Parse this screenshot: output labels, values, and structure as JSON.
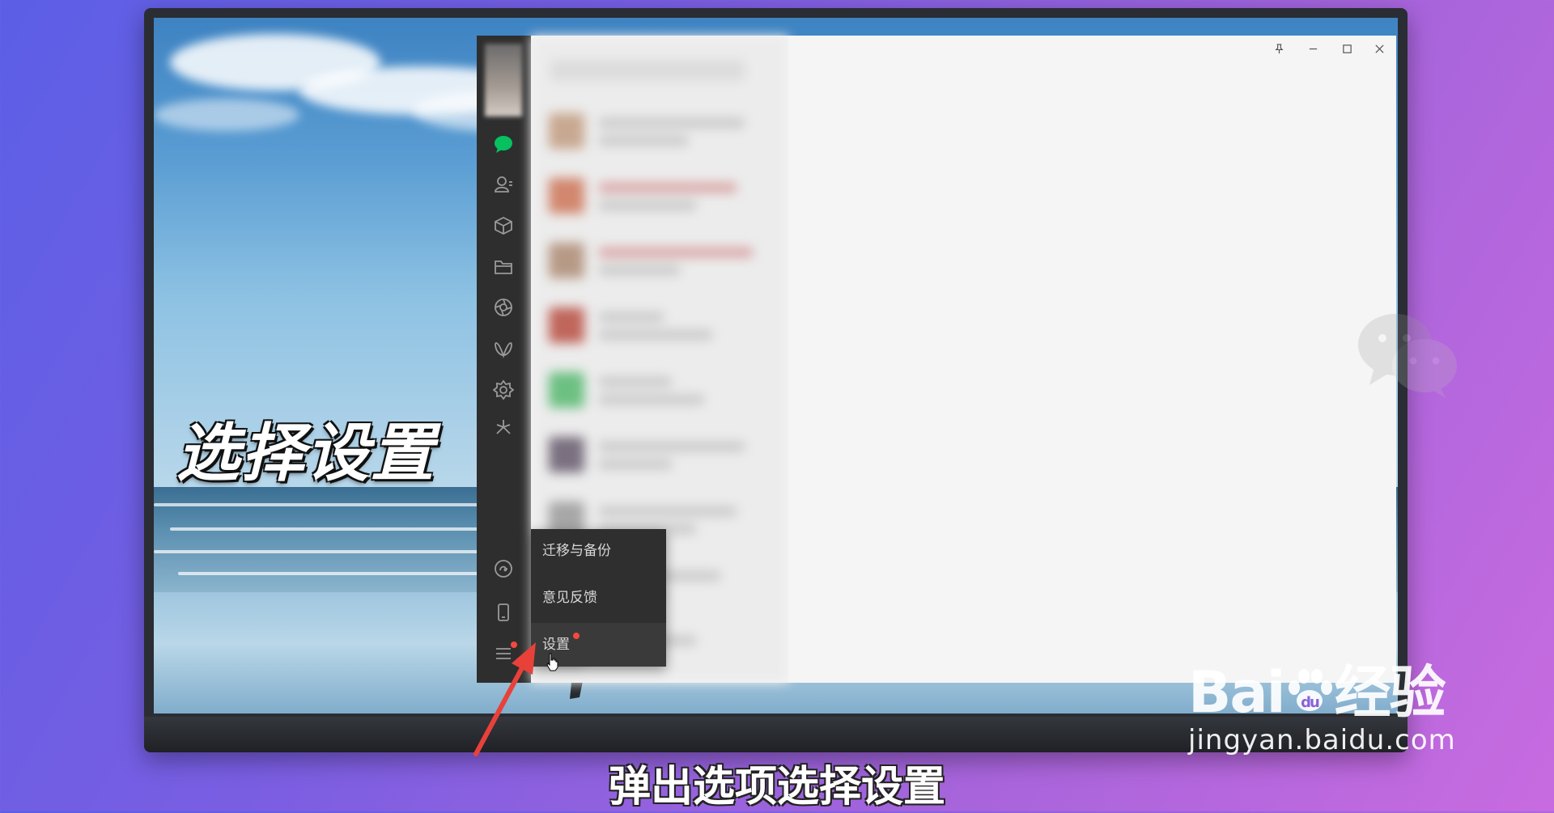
{
  "overlay": {
    "caption": "选择设置",
    "subtitle": "弹出选项选择设置"
  },
  "window_controls": [
    "pin-icon",
    "minimize-icon",
    "maximize-icon",
    "close-icon"
  ],
  "sidebar": {
    "icons": [
      "chat-icon",
      "contacts-icon",
      "favorites-icon",
      "files-icon",
      "moments-icon",
      "channels-icon",
      "mini-programs-icon",
      "search-feature-icon",
      "miniprogram-link-icon",
      "phone-icon",
      "menu-icon"
    ],
    "accent_color": "#07c160"
  },
  "popup_menu": {
    "items": [
      {
        "label": "迁移与备份"
      },
      {
        "label": "意见反馈"
      },
      {
        "label": "设置"
      }
    ]
  },
  "watermark": {
    "brand": "Bai",
    "brand_suffix": "经验",
    "url": "jingyan.baidu.com"
  },
  "colors": {
    "sidebar_bg": "#2e2e2e",
    "menu_bg": "#2f2f2f",
    "notification_dot": "#f24a3c",
    "arrow": "#e8413a"
  }
}
